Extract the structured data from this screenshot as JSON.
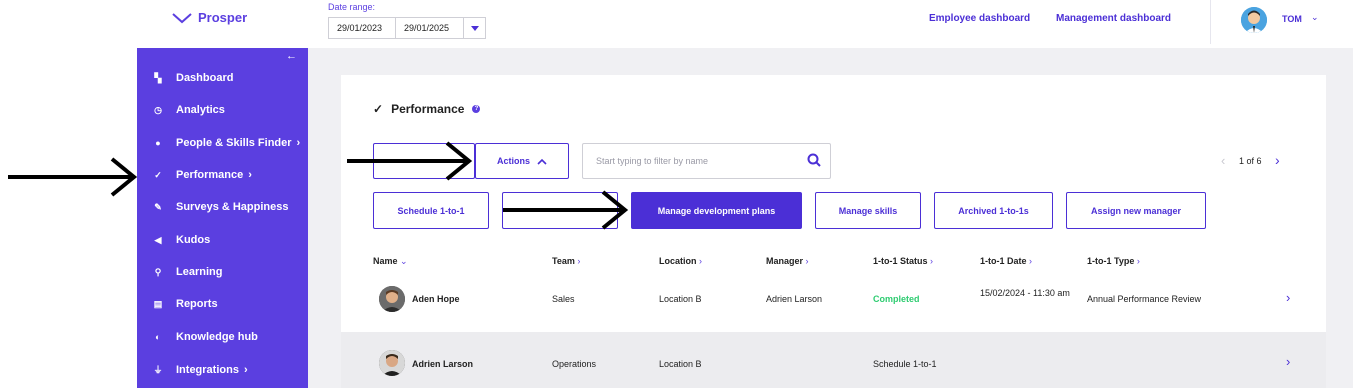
{
  "app": {
    "name": "Prosper"
  },
  "date_range": {
    "label": "Date range:",
    "from": "29/01/2023",
    "to": "29/01/2025"
  },
  "header": {
    "links": [
      "Employee dashboard",
      "Management dashboard"
    ],
    "user": "TOM"
  },
  "sidebar": {
    "items": [
      {
        "label": "Dashboard",
        "icon": "dashboard-icon"
      },
      {
        "label": "Analytics",
        "icon": "analytics-icon"
      },
      {
        "label": "People & Skills Finder",
        "icon": "person-icon",
        "has_submenu": true
      },
      {
        "label": "Performance",
        "icon": "checkmark-icon",
        "has_submenu": true
      },
      {
        "label": "Surveys & Happiness",
        "icon": "survey-icon"
      },
      {
        "label": "Kudos",
        "icon": "megaphone-icon"
      },
      {
        "label": "Learning",
        "icon": "learning-icon"
      },
      {
        "label": "Reports",
        "icon": "report-icon"
      },
      {
        "label": "Knowledge hub",
        "icon": "knowledge-icon"
      },
      {
        "label": "Integrations",
        "icon": "plug-icon",
        "has_submenu": true
      }
    ]
  },
  "page": {
    "title": "Performance"
  },
  "toolbar": {
    "actions_label": "Actions",
    "search_placeholder": "Start typing to filter by name",
    "pagination": "1 of 6"
  },
  "action_buttons": {
    "schedule": "Schedule 1-to-1",
    "manage_dev": "Manage development plans",
    "manage_skills": "Manage skills",
    "archived": "Archived 1-to-1s",
    "assign": "Assign new manager"
  },
  "table": {
    "columns": [
      "Name",
      "Team",
      "Location",
      "Manager",
      "1-to-1 Status",
      "1-to-1 Date",
      "1-to-1 Type"
    ],
    "rows": [
      {
        "name": "Aden Hope",
        "team": "Sales",
        "location": "Location B",
        "manager": "Adrien Larson",
        "status": "Completed",
        "date": "15/02/2024 - 11:30 am",
        "type": "Annual Performance Review"
      },
      {
        "name": "Adrien Larson",
        "team": "Operations",
        "location": "Location B",
        "manager": "",
        "status": "Schedule 1-to-1",
        "date": "",
        "type": ""
      }
    ]
  },
  "colors": {
    "brand": "#5b3fe0",
    "accent": "#4b2fd6",
    "success": "#2ecc71"
  }
}
